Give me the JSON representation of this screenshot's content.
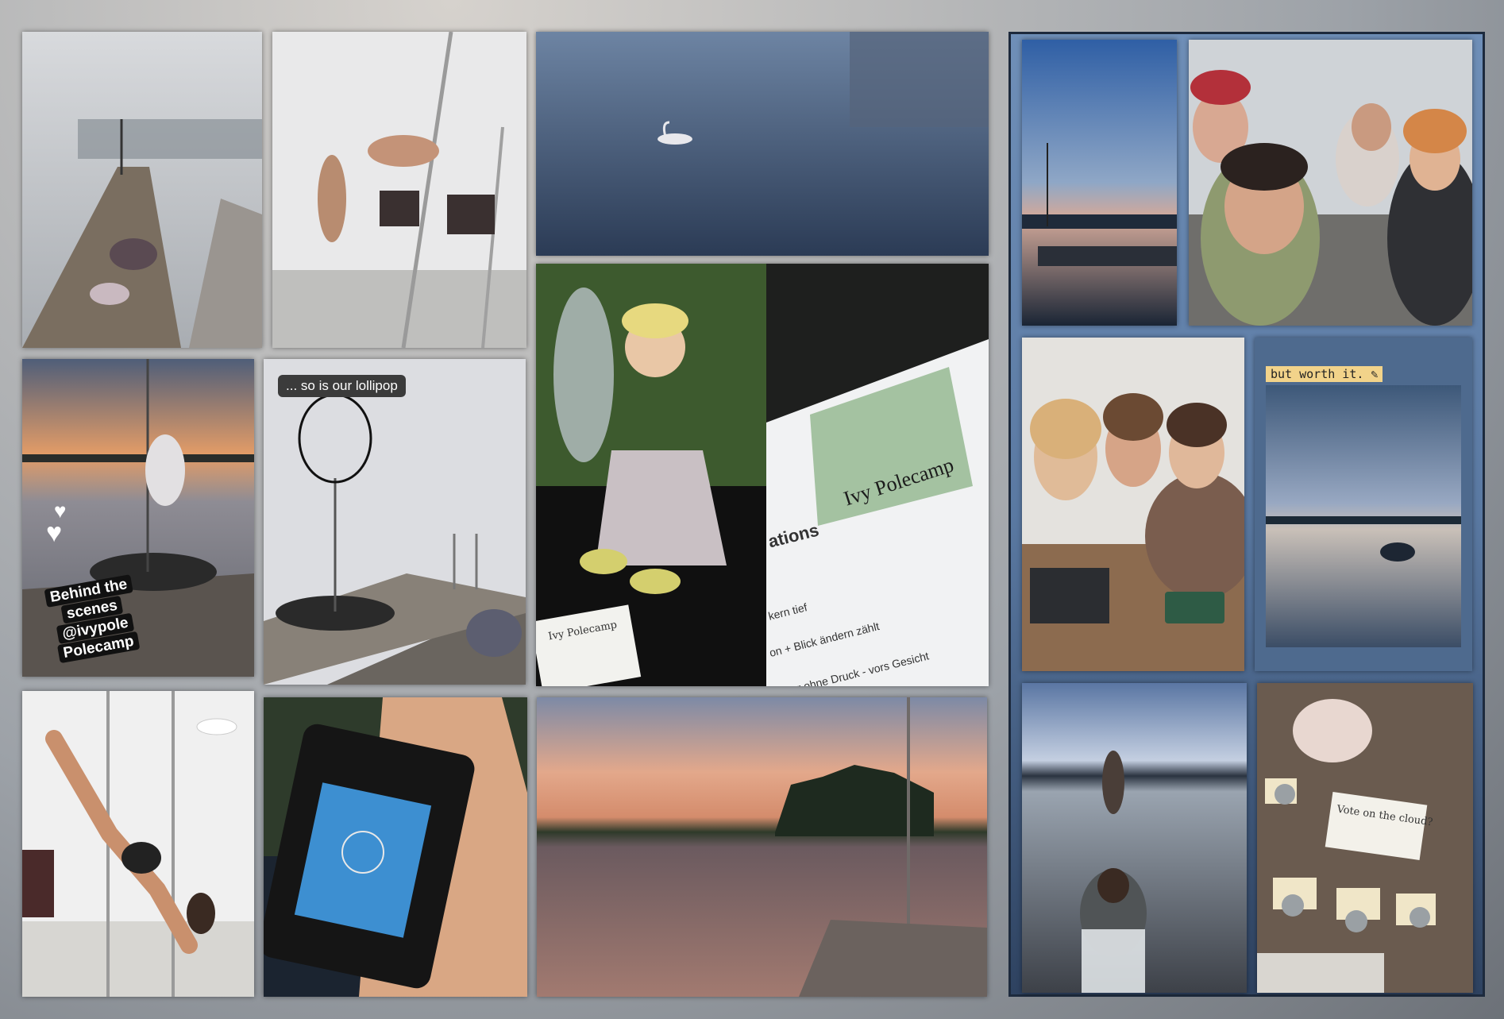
{
  "collage": {
    "caption_lollipop": "... so is our lollipop",
    "story_text": [
      "Behind the",
      "scenes",
      "@ivypole",
      "Polecamp"
    ],
    "tag_worth_it": "but worth it. ✎",
    "document": {
      "logo_text": "Ivy Polecamp",
      "heading_fragment": "ations",
      "lines": [
        "kern tief",
        "on + Blick ändern zählt",
        "körper ohne Druck - vors Gesicht"
      ]
    },
    "card_small": "Ivy Polecamp",
    "note_card": [
      "Vote on",
      "the",
      "cloud?"
    ]
  },
  "colors": {
    "right_panel": "#5a79a2",
    "lake_dawn": "#3f5673",
    "sunset": "#d88a6d",
    "logo_green": "#8fb89a"
  }
}
